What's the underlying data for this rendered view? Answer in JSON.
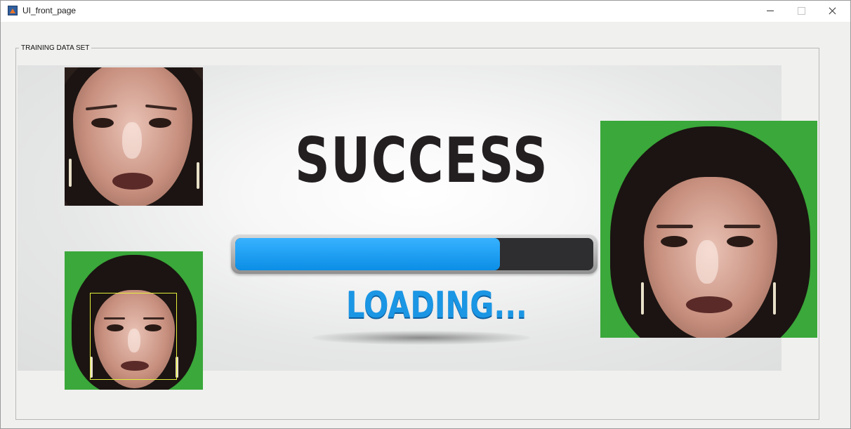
{
  "window": {
    "title": "UI_front_page",
    "icon": "matlab-icon",
    "controls": [
      "minimize-icon",
      "maximize-icon",
      "close-icon"
    ]
  },
  "panel": {
    "title": "TRAINING DATA SET"
  },
  "banner": {
    "heading": "SUCCESS",
    "loading_text": "LOADING...",
    "progress_percent": 74,
    "colors": {
      "heading": "#231f20",
      "progress_fill": "#1a9cf0",
      "loading": "#1a96e4"
    }
  },
  "images": {
    "top_left": "face-crop-image",
    "bottom_left": "face-detection-image",
    "right": "face-image"
  },
  "colors": {
    "background": "#f0f0ee",
    "detection_box": "#e4ef3a",
    "green_screen": "#3aa83a"
  }
}
